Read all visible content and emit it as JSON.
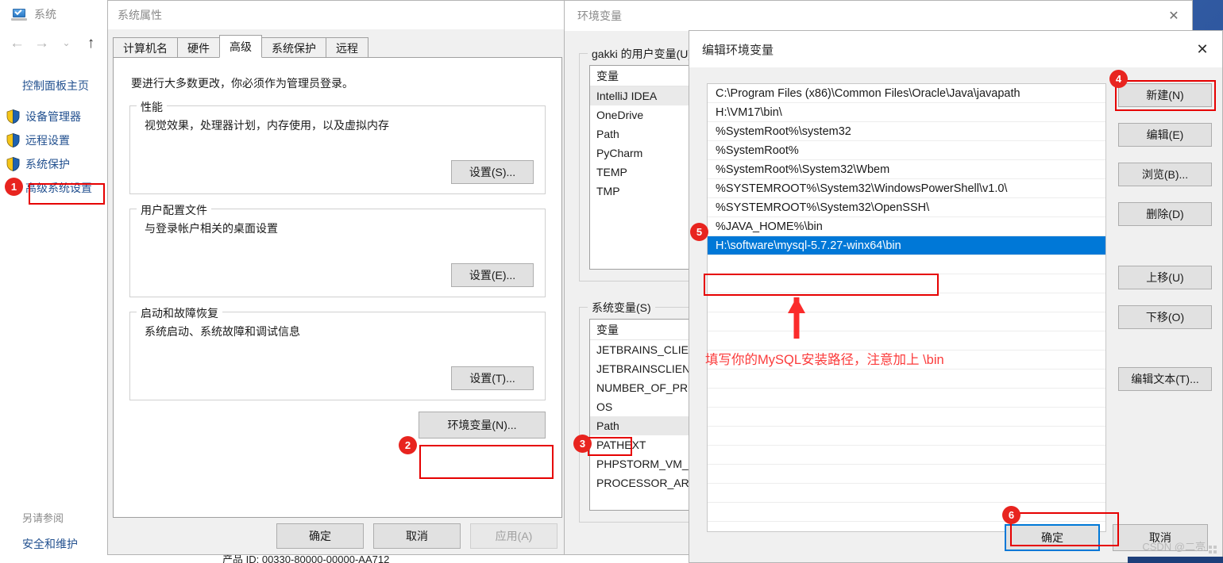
{
  "system_window": {
    "title": "系统",
    "nav": {
      "back": "←",
      "forward": "→",
      "recent": "⌄",
      "up": "↑"
    },
    "sidebar": {
      "home": "控制面板主页",
      "items": [
        {
          "label": "设备管理器"
        },
        {
          "label": "远程设置"
        },
        {
          "label": "系统保护"
        },
        {
          "label": "高级系统设置"
        }
      ],
      "see_also_label": "另请参阅",
      "see_also_link": "安全和维护"
    },
    "product_id": "产品 ID: 00330-80000-00000-AA712"
  },
  "system_properties": {
    "title": "系统属性",
    "tabs": [
      {
        "label": "计算机名",
        "active": false
      },
      {
        "label": "硬件",
        "active": false
      },
      {
        "label": "高级",
        "active": true
      },
      {
        "label": "系统保护",
        "active": false
      },
      {
        "label": "远程",
        "active": false
      }
    ],
    "notice": "要进行大多数更改，你必须作为管理员登录。",
    "groups": [
      {
        "title": "性能",
        "desc": "视觉效果，处理器计划，内存使用，以及虚拟内存",
        "button": "设置(S)..."
      },
      {
        "title": "用户配置文件",
        "desc": "与登录帐户相关的桌面设置",
        "button": "设置(E)..."
      },
      {
        "title": "启动和故障恢复",
        "desc": "系统启动、系统故障和调试信息",
        "button": "设置(T)..."
      }
    ],
    "env_button": "环境变量(N)...",
    "footer": {
      "ok": "确定",
      "cancel": "取消",
      "apply": "应用(A)"
    }
  },
  "environment_variables": {
    "title": "环境变量",
    "close_icon": "✕",
    "user_group_title": "gakki 的用户变量(U)",
    "system_group_title": "系统变量(S)",
    "column_header": "变量",
    "user_variables": [
      {
        "name": "IntelliJ IDEA",
        "selected": true
      },
      {
        "name": "OneDrive",
        "selected": false
      },
      {
        "name": "Path",
        "selected": false
      },
      {
        "name": "PyCharm",
        "selected": false
      },
      {
        "name": "TEMP",
        "selected": false
      },
      {
        "name": "TMP",
        "selected": false
      }
    ],
    "system_variables": [
      {
        "name": "JETBRAINS_CLIEN",
        "selected": false
      },
      {
        "name": "JETBRAINSCLIEN",
        "selected": false
      },
      {
        "name": "NUMBER_OF_PR",
        "selected": false
      },
      {
        "name": "OS",
        "selected": false
      },
      {
        "name": "Path",
        "selected": true
      },
      {
        "name": "PATHEXT",
        "selected": false
      },
      {
        "name": "PHPSTORM_VM_",
        "selected": false
      },
      {
        "name": "PROCESSOR_AR",
        "selected": false
      }
    ]
  },
  "edit_variable": {
    "title": "编辑环境变量",
    "close_icon": "✕",
    "path_entries": [
      {
        "value": "C:\\Program Files (x86)\\Common Files\\Oracle\\Java\\javapath",
        "selected": false
      },
      {
        "value": "H:\\VM17\\bin\\",
        "selected": false
      },
      {
        "value": "%SystemRoot%\\system32",
        "selected": false
      },
      {
        "value": "%SystemRoot%",
        "selected": false
      },
      {
        "value": "%SystemRoot%\\System32\\Wbem",
        "selected": false
      },
      {
        "value": "%SYSTEMROOT%\\System32\\WindowsPowerShell\\v1.0\\",
        "selected": false
      },
      {
        "value": "%SYSTEMROOT%\\System32\\OpenSSH\\",
        "selected": false
      },
      {
        "value": "%JAVA_HOME%\\bin",
        "selected": false
      },
      {
        "value": "H:\\software\\mysql-5.7.27-winx64\\bin",
        "selected": true
      }
    ],
    "buttons": [
      {
        "label": "新建(N)"
      },
      {
        "label": "编辑(E)"
      },
      {
        "label": "浏览(B)..."
      },
      {
        "label": "删除(D)"
      },
      {
        "label": "上移(U)"
      },
      {
        "label": "下移(O)"
      },
      {
        "label": "编辑文本(T)..."
      }
    ],
    "footer": {
      "ok": "确定",
      "cancel": "取消"
    },
    "annotation": "填写你的MySQL安装路径，注意加上 \\bin"
  },
  "step_badges": {
    "one": "1",
    "two": "2",
    "three": "3",
    "four": "4",
    "five": "5",
    "six": "6"
  },
  "watermark": "CSDN @二亮",
  "colors": {
    "highlight_red": "#e60000",
    "badge_red": "#e8241f",
    "selection_blue": "#0078d7",
    "annotation_red": "#fb3b3b",
    "link_blue": "#22508f"
  }
}
